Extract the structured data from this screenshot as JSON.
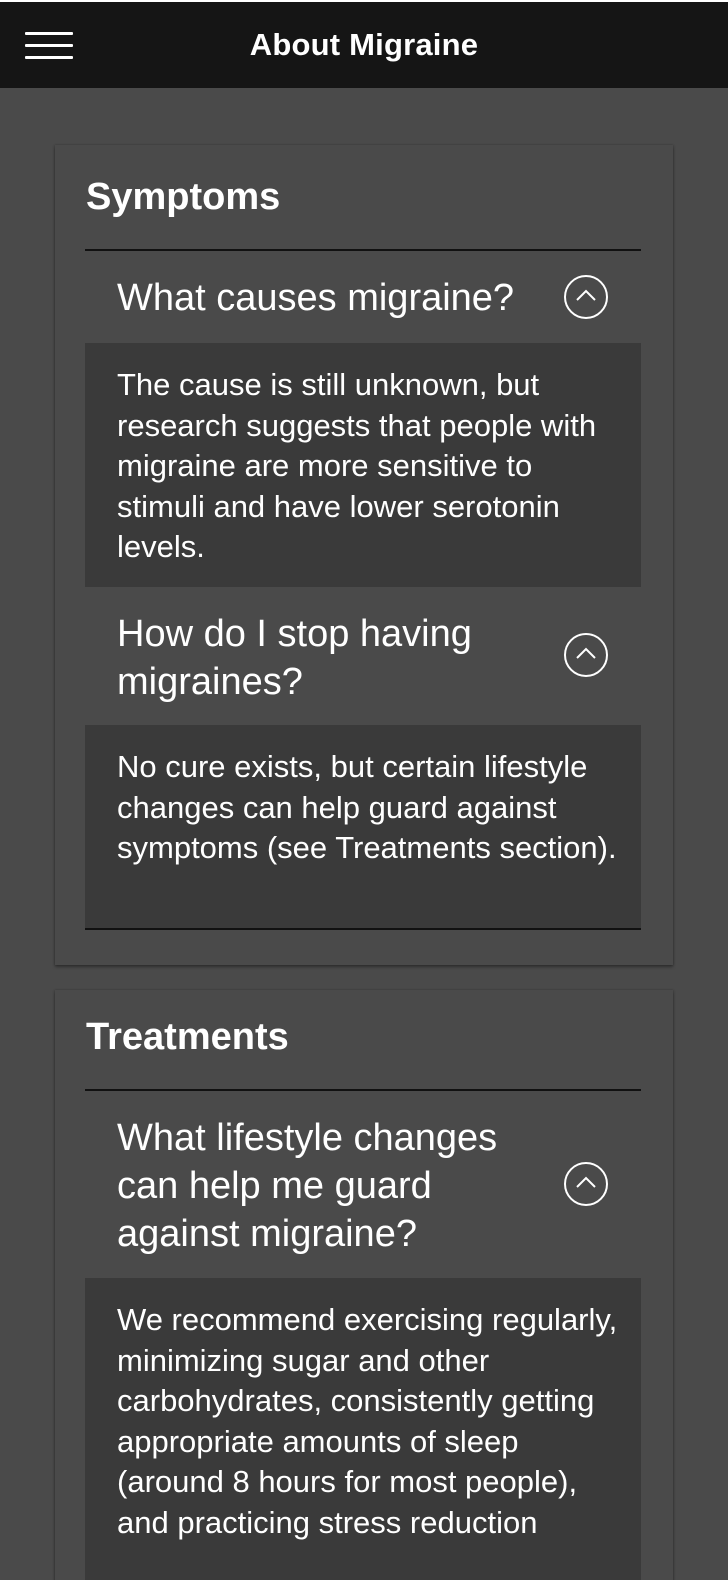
{
  "header": {
    "title": "About Migraine",
    "menu_icon": "hamburger-menu-icon"
  },
  "sections": [
    {
      "title": "Symptoms",
      "items": [
        {
          "question": "What causes migraine?",
          "answer": "The cause is still unknown, but research suggests that people with migraine are more sensitive to stimuli and have lower serotonin levels.",
          "icon": "chevron-up-icon"
        },
        {
          "question": "How do I stop having migraines?",
          "answer": "No cure exists, but certain lifestyle changes can help guard against symptoms (see Treatments section).",
          "icon": "chevron-up-icon"
        }
      ]
    },
    {
      "title": "Treatments",
      "items": [
        {
          "question": "What lifestyle changes can help me guard against migraine?",
          "answer": "We recommend exercising regularly, minimizing sugar and other carbohydrates, consistently getting appropriate amounts of sleep (around 8 hours for most people), and practicing stress reduction",
          "icon": "chevron-up-icon"
        }
      ]
    }
  ],
  "colors": {
    "background": "#4a4a4a",
    "header": "#151515",
    "answer_panel": "#3a3a3a",
    "text": "#ffffff"
  }
}
